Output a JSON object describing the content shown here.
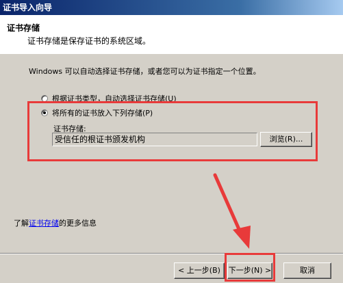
{
  "window": {
    "title": "证书导入向导"
  },
  "header": {
    "title": "证书存储",
    "subtitle": "证书存储是保存证书的系统区域。"
  },
  "body": {
    "description": "Windows 可以自动选择证书存储，或者您可以为证书指定一个位置。",
    "option_auto": "根据证书类型，自动选择证书存储(U)",
    "option_manual": "将所有的证书放入下列存储(P)",
    "selected_option": "manual",
    "store_label": "证书存储:",
    "store_value": "受信任的根证书颁发机构",
    "browse_label": "浏览(R)...",
    "more_info_prefix": "了解",
    "more_info_link": "证书存储",
    "more_info_suffix": "的更多信息"
  },
  "footer": {
    "back_label": "< 上一步(B)",
    "next_label": "下一步(N) >",
    "cancel_label": "取消"
  },
  "colors": {
    "annotation": "#e83a3a",
    "titlebar": "#0a246a",
    "link": "#0000ee"
  }
}
